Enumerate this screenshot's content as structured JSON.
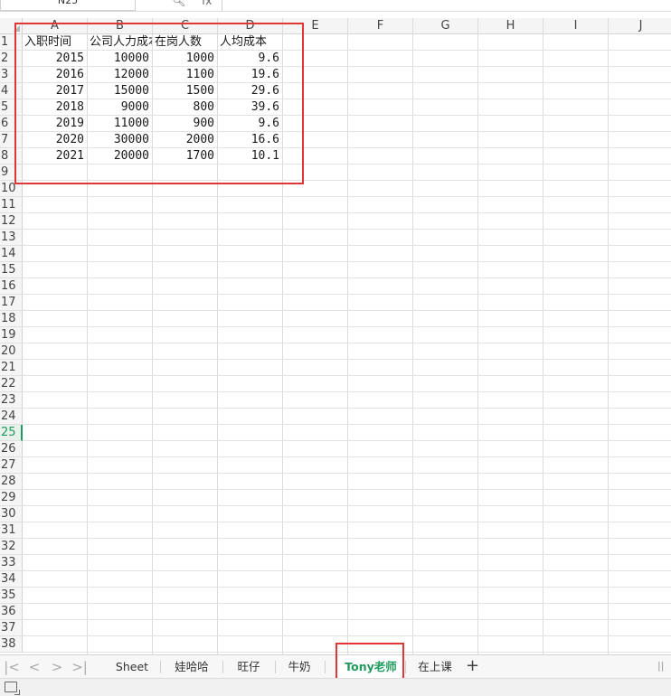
{
  "formula_bar": {
    "name_box": "N25",
    "zoom_icon": "magnifier-icon",
    "fx_label": "fx",
    "formula_value": ""
  },
  "columns": [
    "A",
    "B",
    "C",
    "D",
    "E",
    "F",
    "G",
    "H",
    "I",
    "J"
  ],
  "rows": [
    "1",
    "2",
    "3",
    "4",
    "5",
    "6",
    "7",
    "8",
    "9",
    "10",
    "11",
    "12",
    "13",
    "14",
    "15",
    "16",
    "17",
    "18",
    "19",
    "20",
    "21",
    "22",
    "23",
    "24",
    "25",
    "26",
    "27",
    "28",
    "29",
    "30",
    "31",
    "32",
    "33",
    "34",
    "35",
    "36",
    "37",
    "38"
  ],
  "active_row": "25",
  "sheet": {
    "headers": [
      "入职时间",
      "公司人力成本",
      "在岗人数",
      "人均成本"
    ],
    "data": [
      [
        "2015",
        "10000",
        "1000",
        "9.6"
      ],
      [
        "2016",
        "12000",
        "1100",
        "19.6"
      ],
      [
        "2017",
        "15000",
        "1500",
        "29.6"
      ],
      [
        "2018",
        "9000",
        "800",
        "39.6"
      ],
      [
        "2019",
        "11000",
        "900",
        "9.6"
      ],
      [
        "2020",
        "30000",
        "2000",
        "16.6"
      ],
      [
        "2021",
        "20000",
        "1700",
        "10.1"
      ]
    ]
  },
  "tabs": [
    {
      "label": "Sheet",
      "active": false
    },
    {
      "label": "娃哈哈",
      "active": false
    },
    {
      "label": "旺仔",
      "active": false
    },
    {
      "label": "牛奶",
      "active": false
    },
    {
      "label": "Tony老师",
      "active": true
    },
    {
      "label": "在上课",
      "active": false
    }
  ],
  "nav": {
    "first": "|<",
    "prev": "<",
    "next": ">",
    "last": ">|",
    "add": "+"
  },
  "colors": {
    "accent": "#1f9a5d",
    "highlight": "#e03636"
  }
}
